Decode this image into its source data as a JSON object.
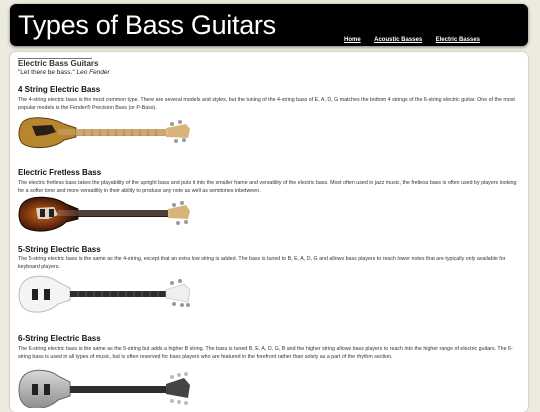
{
  "site": {
    "title": "Types of Bass Guitars"
  },
  "nav": {
    "items": [
      "Home",
      "Acoustic Basses",
      "Electric Basses"
    ]
  },
  "intro": {
    "title": "Electric Bass Guitars",
    "quote": "\"Let there be bass.\"",
    "author": "Leo Fender"
  },
  "sections": [
    {
      "heading": "4 String Electric Bass",
      "text": "The 4-string electric bass is the most common type. There are several models and styles, but the tuning of the 4-string bass of E, A, D, G matches the bottom 4 strings of the 6-string electric guitar. One of the most popular models is the Fender® Precision Bass (or P-Bass).",
      "image_icon": "natural-wood-precision-bass"
    },
    {
      "heading": "Electric Fretless Bass",
      "text": "The electric fretless bass takes the playability of the upright bass and puts it into the smaller frame and versatility of the electric bass. Most often used in jazz music, the fretless bass is often used by players looking for a softer tone and more versatility in their ability to produce any note as well as semitones inbetween.",
      "image_icon": "sunburst-fretless-bass"
    },
    {
      "heading": "5-String Electric Bass",
      "text": "The 5-string electric bass is the same as the 4-string, except that an extra low string is added. The bass is tuned to B, E, A, D, G and allows bass players to reach lower notes that are typically only available for keyboard players.",
      "image_icon": "white-5-string-bass"
    },
    {
      "heading": "6-String Electric Bass",
      "text": "The 6-string electric bass is the same as the 5-string but adds a higher B string. The bass is tuned B, E, A, D, G, B and the higher string allows bass players to reach into the higher range of electric guitars. The 6-string bass is used in all types of music, but is often reserved for bass players who are featured in the forefront rather than solely as a part of the rhythm section.",
      "image_icon": "silver-6-string-bass"
    }
  ]
}
